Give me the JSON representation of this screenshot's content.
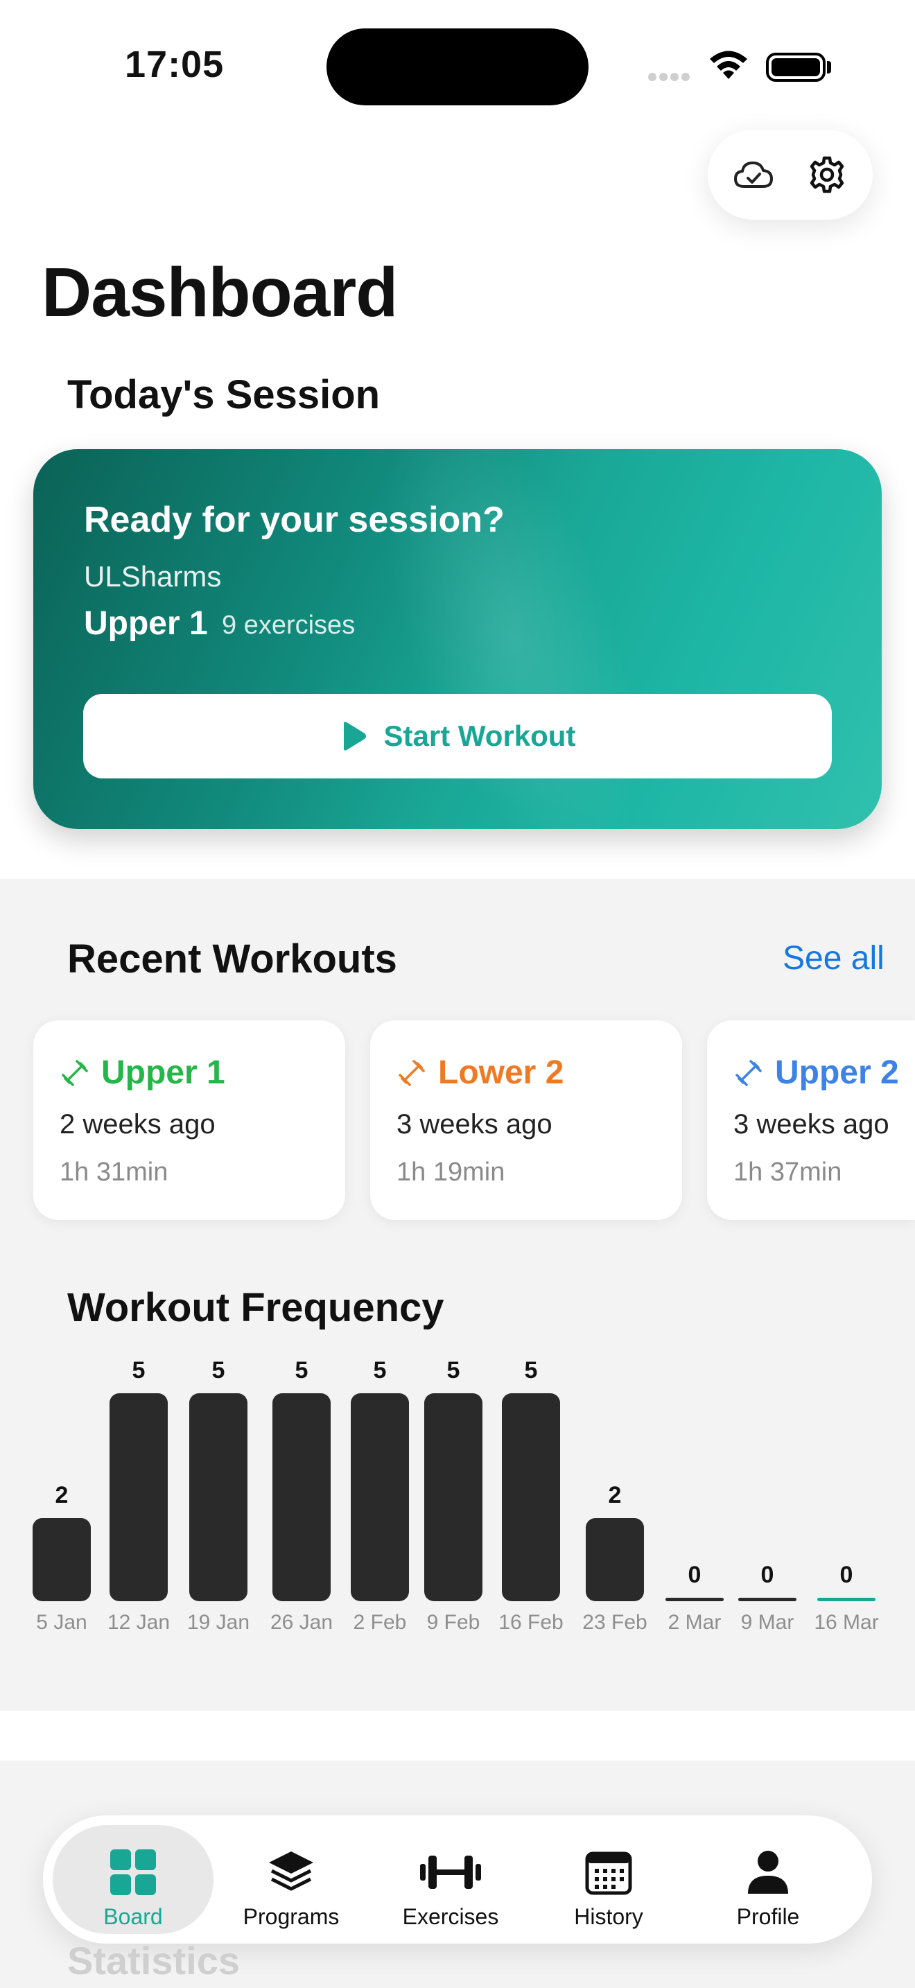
{
  "status_bar": {
    "time": "17:05"
  },
  "header": {
    "title": "Dashboard"
  },
  "todays_session": {
    "section_title": "Today's Session",
    "heading": "Ready for your session?",
    "program": "ULSharms",
    "day": "Upper 1",
    "exercise_count": "9 exercises",
    "start_label": "Start Workout"
  },
  "recent_workouts": {
    "section_title": "Recent Workouts",
    "see_all_label": "See all",
    "items": [
      {
        "name": "Upper 1",
        "ago": "2 weeks ago",
        "duration": "1h 31min",
        "color": "#26b548"
      },
      {
        "name": "Lower 2",
        "ago": "3 weeks ago",
        "duration": "1h 19min",
        "color": "#ef7a24"
      },
      {
        "name": "Upper 2",
        "ago": "3 weeks ago",
        "duration": "1h 37min",
        "color": "#3d83e6"
      }
    ]
  },
  "workout_frequency": {
    "section_title": "Workout Frequency"
  },
  "chart_data": {
    "type": "bar",
    "categories": [
      "5 Jan",
      "12 Jan",
      "19 Jan",
      "26 Jan",
      "2 Feb",
      "9 Feb",
      "16 Feb",
      "23 Feb",
      "2 Mar",
      "9 Mar",
      "16 Mar"
    ],
    "values": [
      2,
      5,
      5,
      5,
      5,
      5,
      5,
      2,
      0,
      0,
      0
    ],
    "bar_color": "#2a2a2a",
    "highlight_color": "#17a794",
    "highlight_index": 10
  },
  "statistics": {
    "section_title": "Statistics"
  },
  "tab_bar": {
    "tabs": [
      {
        "label": "Board",
        "icon": "grid-icon",
        "active": true
      },
      {
        "label": "Programs",
        "icon": "layers-icon"
      },
      {
        "label": "Exercises",
        "icon": "dumbbell-icon"
      },
      {
        "label": "History",
        "icon": "calendar-icon"
      },
      {
        "label": "Profile",
        "icon": "person-icon"
      }
    ]
  },
  "colors": {
    "accent": "#17a794",
    "link": "#1677e0"
  }
}
